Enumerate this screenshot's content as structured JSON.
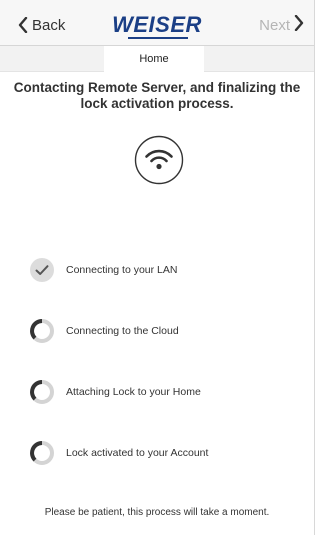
{
  "nav": {
    "back_label": "Back",
    "brand": "WEISER",
    "next_label": "Next"
  },
  "tabs": {
    "home_label": "Home"
  },
  "main": {
    "title": "Contacting Remote Server, and finalizing the lock activation process.",
    "steps": [
      {
        "label": "Connecting to your LAN",
        "status": "complete"
      },
      {
        "label": "Connecting to the Cloud",
        "status": "in-progress"
      },
      {
        "label": "Attaching Lock to your Home",
        "status": "in-progress"
      },
      {
        "label": "Lock activated to your Account",
        "status": "in-progress"
      }
    ],
    "footer_text": "Please be patient, this process will take a moment."
  },
  "colors": {
    "brand": "#1b3f86",
    "disabled_text": "#b5b5b5",
    "complete_circle": "#dcdcdc",
    "spinner_dark": "#333333"
  }
}
